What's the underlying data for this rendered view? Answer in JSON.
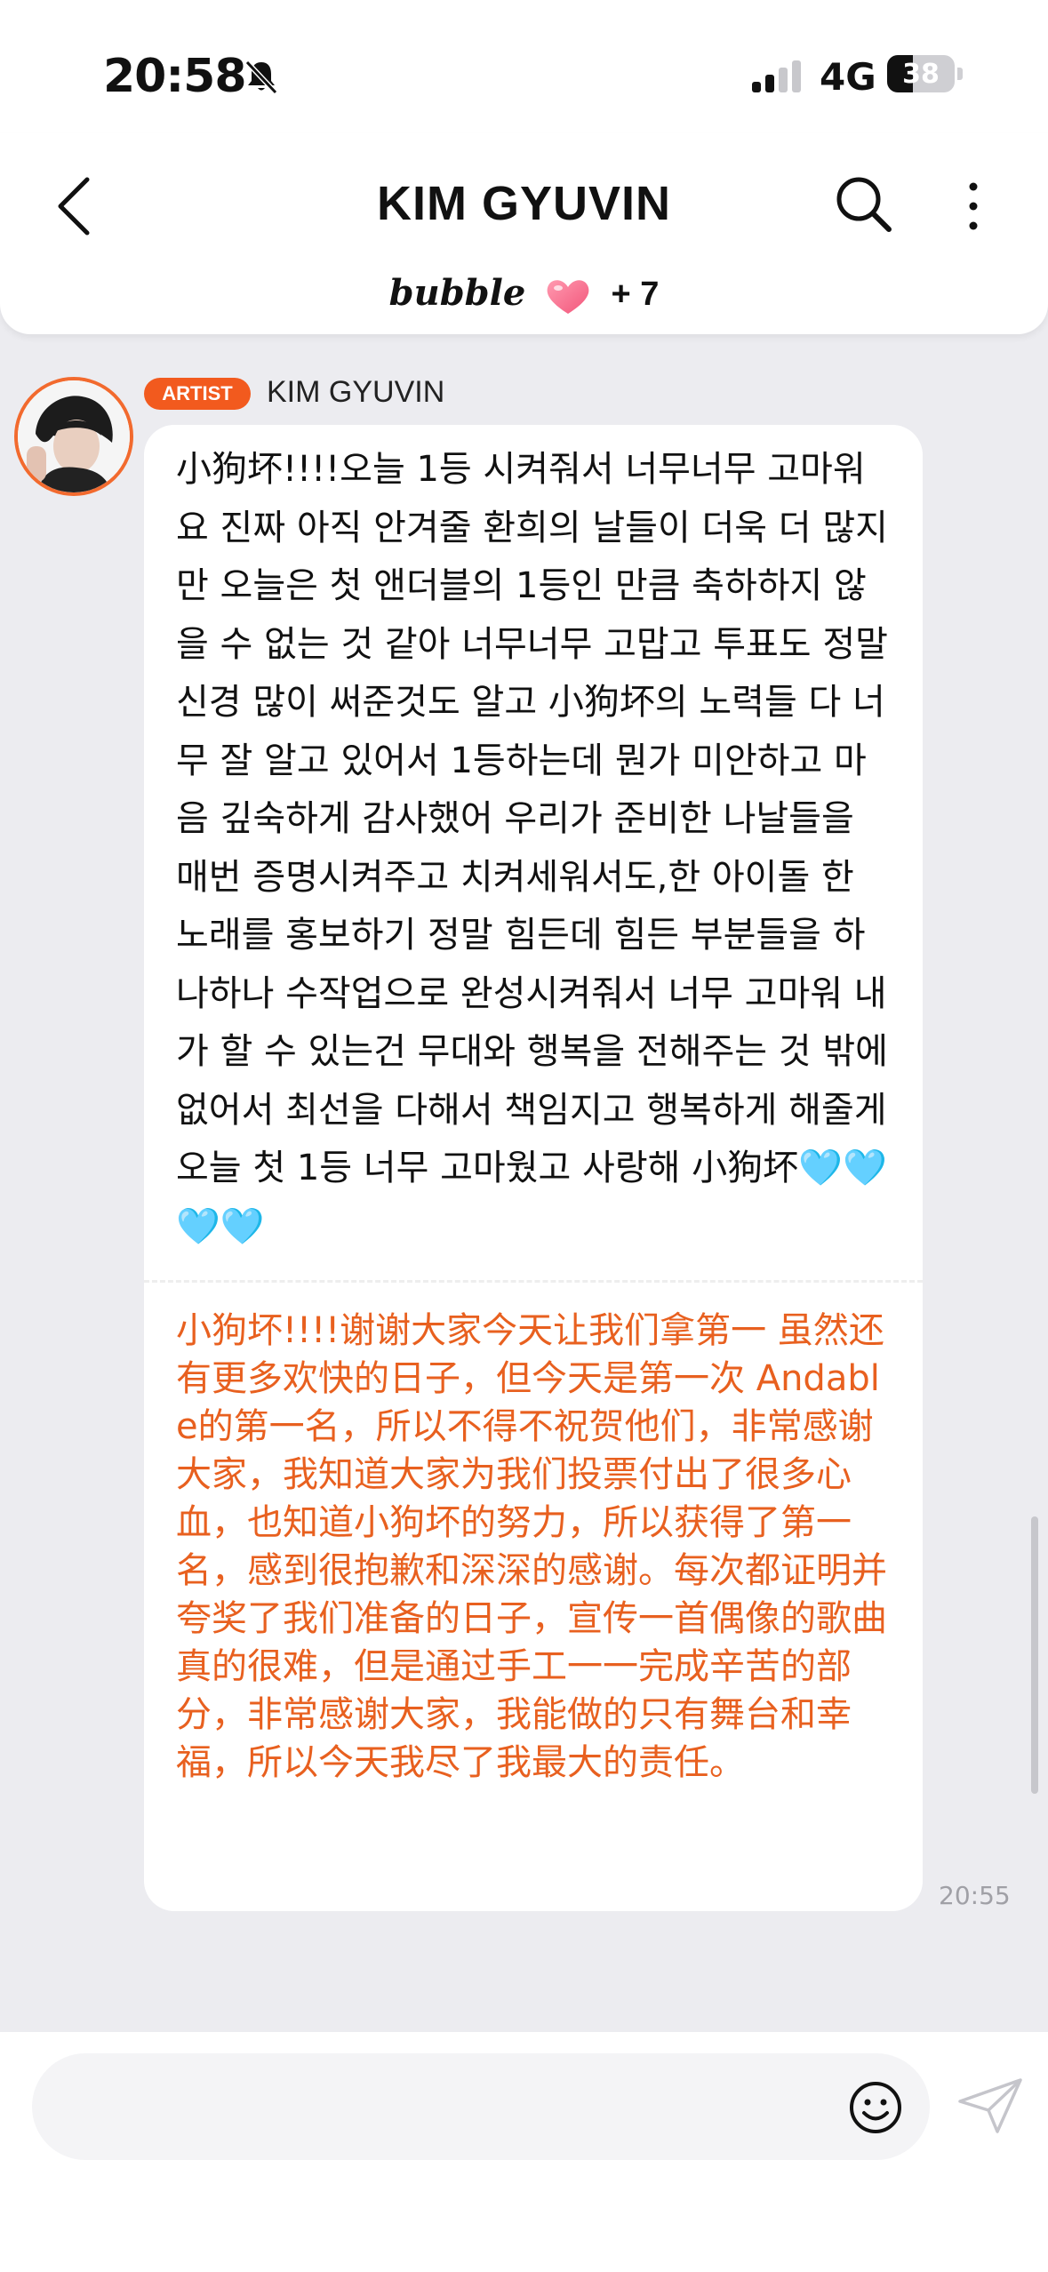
{
  "status_bar": {
    "time": "20:58",
    "network": "4G",
    "battery": "38",
    "battery_level": 0.38
  },
  "header": {
    "title": "KIM GYUVIN",
    "bubble_logo": "bubble",
    "bubble_count": "+ 7"
  },
  "message": {
    "badge": "ARTIST",
    "sender": "KIM GYUVIN",
    "text": "小狗坏!!!!오늘 1등 시켜줘서 너무너무 고마워요 진짜 아직 안겨줄 환희의 날들이 더욱 더 많지만 오늘은 첫 앤더블의 1등인 만큼 축하하지 않을 수 없는 것 같아 너무너무 고맙고 투표도 정말 신경 많이 써준것도 알고 小狗坏의 노력들 다 너무 잘 알고 있어서 1등하는데 뭔가 미안하고 마음 깊숙하게 감사했어 우리가 준비한 나날들을 매번 증명시켜주고 치켜세워서도,한 아이돌 한 노래를 홍보하기 정말 힘든데 힘든 부분들을 하나하나 수작업으로 완성시켜줘서 너무 고마워 내가 할 수 있는건 무대와 행복을 전해주는 것 밖에 없어서 최선을 다해서 책임지고 행복하게 해줄게 오늘 첫 1등 너무 고마웠고 사랑해 小狗坏🩵🩵🩵🩵",
    "translation": "小狗坏!!!!谢谢大家今天让我们拿第一 虽然还有更多欢快的日子，但今天是第一次 Andable的第一名，所以不得不祝贺他们，非常感谢大家，我知道大家为我们投票付出了很多心血，也知道小狗坏的努力，所以获得了第一名，感到很抱歉和深深的感谢。每次都证明并夸奖了我们准备的日子，宣传一首偶像的歌曲真的很难，但是通过手工一一完成辛苦的部分，非常感谢大家，我能做的只有舞台和幸福，所以今天我尽了我最大的责任。",
    "time": "20:55"
  },
  "colors": {
    "accent": "#f25a1e",
    "translation": "#e8601f",
    "background": "#ececf0"
  },
  "icons": {
    "back": "chevron-left-icon",
    "search": "search-icon",
    "more": "more-vertical-icon",
    "emoji": "emoji-icon",
    "send": "send-icon"
  }
}
